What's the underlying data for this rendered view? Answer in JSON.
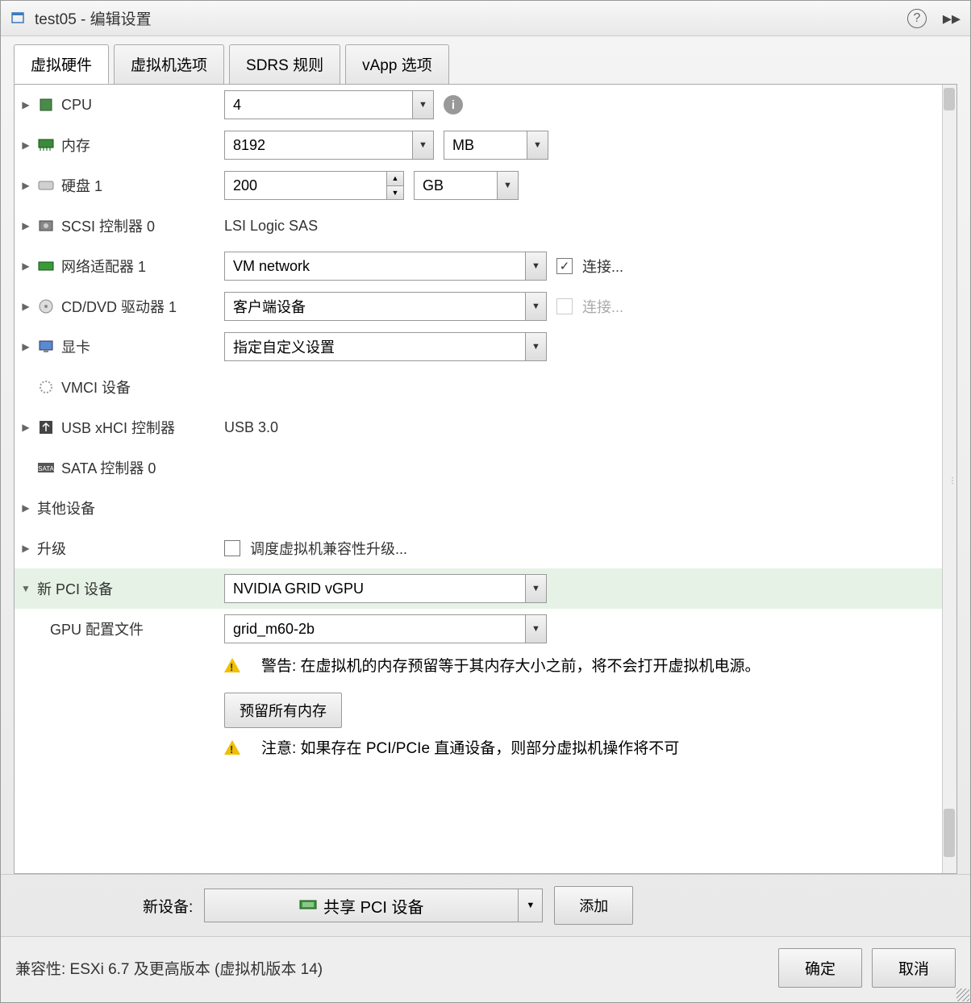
{
  "title": "test05 - 编辑设置",
  "tabs": [
    "虚拟硬件",
    "虚拟机选项",
    "SDRS 规则",
    "vApp 选项"
  ],
  "hardware": {
    "cpu": {
      "label": "CPU",
      "value": "4"
    },
    "memory": {
      "label": "内存",
      "value": "8192",
      "unit": "MB"
    },
    "disk": {
      "label": "硬盘 1",
      "value": "200",
      "unit": "GB"
    },
    "scsi": {
      "label": "SCSI 控制器 0",
      "value": "LSI Logic SAS"
    },
    "network": {
      "label": "网络适配器 1",
      "value": "VM network",
      "connect": "连接..."
    },
    "cddvd": {
      "label": "CD/DVD 驱动器 1",
      "value": "客户端设备",
      "connect": "连接..."
    },
    "video": {
      "label": "显卡",
      "value": "指定自定义设置"
    },
    "vmci": {
      "label": "VMCI 设备"
    },
    "usb": {
      "label": "USB xHCI 控制器",
      "value": "USB 3.0"
    },
    "sata": {
      "label": "SATA 控制器 0"
    },
    "other": {
      "label": "其他设备"
    },
    "upgrade": {
      "label": "升级",
      "checkbox_label": "调度虚拟机兼容性升级..."
    },
    "pci": {
      "label": "新 PCI 设备",
      "value": "NVIDIA GRID vGPU"
    },
    "gpu_profile": {
      "label": "GPU 配置文件",
      "value": "grid_m60-2b"
    },
    "warning1": "警告: 在虚拟机的内存预留等于其内存大小之前，将不会打开虚拟机电源。",
    "reserve_btn": "预留所有内存",
    "warning2": "注意: 如果存在 PCI/PCIe 直通设备，则部分虚拟机操作将不可"
  },
  "new_device": {
    "label": "新设备:",
    "value": "共享 PCI 设备",
    "add_btn": "添加"
  },
  "compatibility": "兼容性: ESXi 6.7 及更高版本 (虚拟机版本 14)",
  "buttons": {
    "ok": "确定",
    "cancel": "取消"
  }
}
